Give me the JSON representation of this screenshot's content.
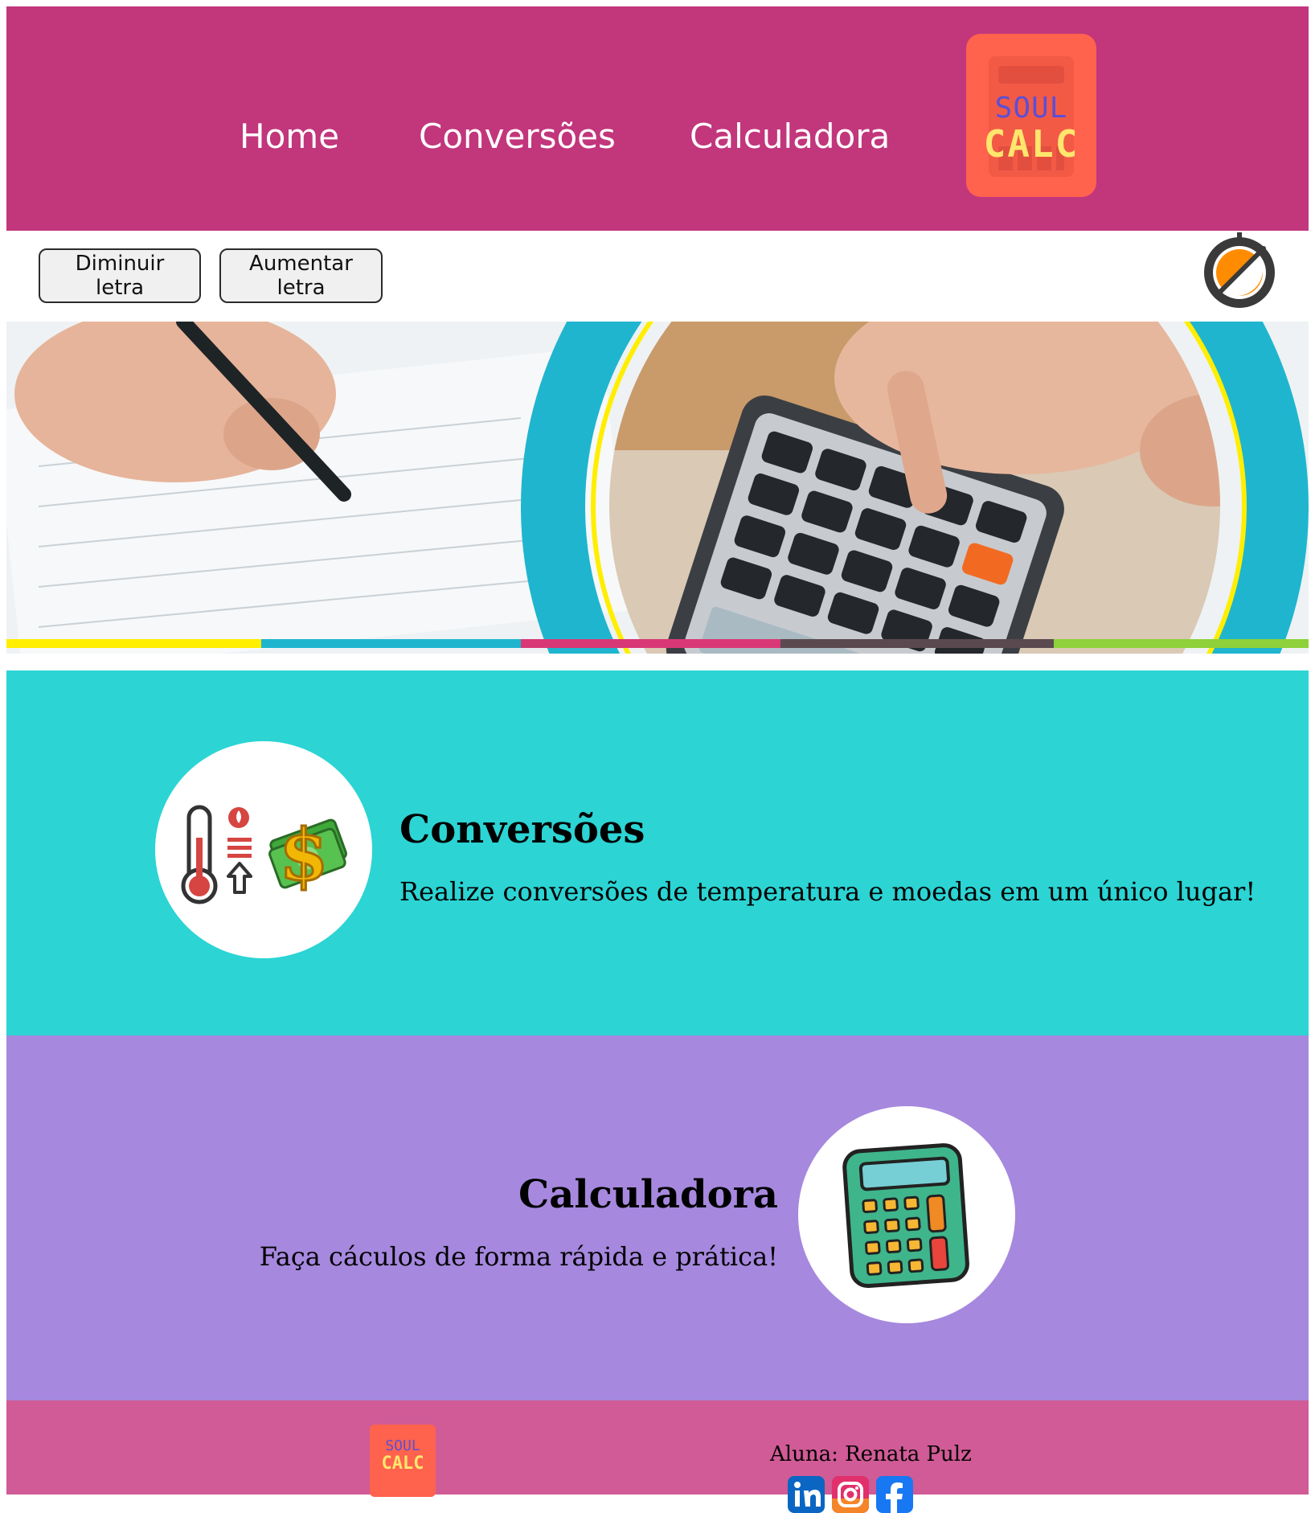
{
  "nav": {
    "items": [
      {
        "label": "Home"
      },
      {
        "label": "Conversões"
      },
      {
        "label": "Calculadora"
      }
    ]
  },
  "logo": {
    "line1": "SOUL",
    "line2": "CALC"
  },
  "toolbar": {
    "decrease_label": "Diminuir letra",
    "increase_label": "Aumentar letra",
    "contrast_icon": "contrast-toggle-icon"
  },
  "banner": {
    "stripe_colors": [
      "#ffee00",
      "#1fb5cf",
      "#d93876",
      "#5a4a4f",
      "#8ed13a"
    ]
  },
  "sections": {
    "conversions": {
      "title": "Conversões",
      "text": "Realize conversões de temperatura e moedas em um único lugar!",
      "icon": "thermometer-money-icon"
    },
    "calculator": {
      "title": "Calculadora",
      "text": "Faça cáculos de forma rápida e prática!",
      "icon": "calculator-icon"
    }
  },
  "footer": {
    "author": "Aluna: Renata Pulz",
    "social": [
      "linkedin-icon",
      "instagram-icon",
      "facebook-icon"
    ]
  },
  "colors": {
    "header": "#c2367c",
    "logo": "#ff624d",
    "conversions_bg": "#2cd4d4",
    "calculator_bg": "#a688de",
    "footer": "#d05b96"
  }
}
